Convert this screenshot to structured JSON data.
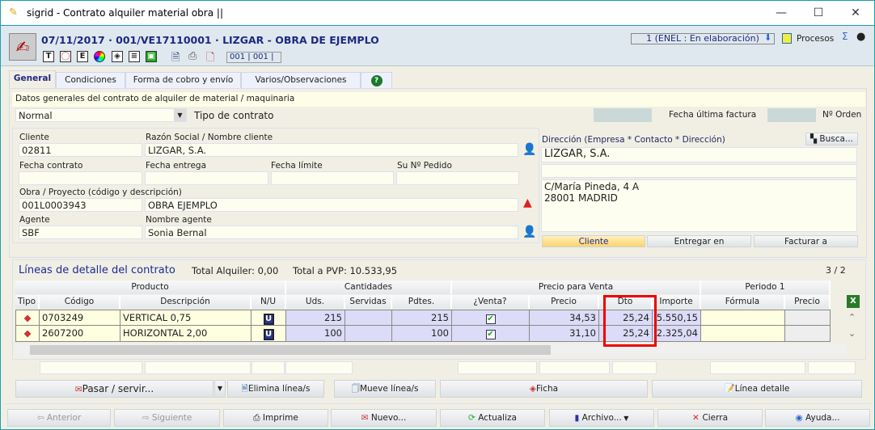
{
  "window": {
    "title": "sigrid - Contrato alquiler material obra ||",
    "controls": [
      "—",
      "☐",
      "✕"
    ]
  },
  "header": {
    "doc_title": "07/11/2017 · 001/VE17110001 · LIZGAR - OBRA DE EJEMPLO",
    "counter": "001 | 001 |",
    "status": "1 (ENEL : En elaboración)",
    "procesos": "Procesos",
    "sigma": "Σ",
    "toolbar_icons": [
      "T",
      "",
      "E",
      "",
      "",
      "",
      "",
      "",
      "",
      ""
    ]
  },
  "tabs": [
    {
      "label": "General"
    },
    {
      "label": "Condiciones"
    },
    {
      "label": "Forma de cobro y envío"
    },
    {
      "label": "Varios/Observaciones"
    },
    {
      "label": "?"
    }
  ],
  "general": {
    "section_title": "Datos generales del contrato de alquiler de material / maquinaria",
    "tipo_value": "Normal",
    "tipo_label": "Tipo de contrato",
    "fecha_ultima_factura_label": "Fecha última factura",
    "n_orden_label": "Nº Orden",
    "cliente_label": "Cliente",
    "cliente": "02811",
    "razon_label": "Razón Social / Nombre cliente",
    "razon": "LIZGAR, S.A.",
    "fecha_contrato_label": "Fecha contrato",
    "fecha_entrega_label": "Fecha entrega",
    "fecha_limite_label": "Fecha límite",
    "pedido_label": "Su Nº Pedido",
    "obra_label": "Obra / Proyecto (código y descripción)",
    "obra_codigo": "001L0003943",
    "obra_desc": "OBRA EJEMPLO",
    "agente_label": "Agente",
    "agente": "SBF",
    "nombre_agente_label": "Nombre agente",
    "nombre_agente": "Sonia Bernal"
  },
  "direccion": {
    "label": "Dirección (Empresa * Contacto * Dirección)",
    "busca": "Busca...",
    "empresa": "LIZGAR, S.A.",
    "contacto": "",
    "linea1": "C/María Pineda, 4 A",
    "linea2": "28001 MADRID",
    "tabs": [
      "Cliente",
      "Entregar en",
      "Facturar a"
    ]
  },
  "lines": {
    "title": "Líneas de detalle del contrato",
    "total_alquiler": "Total Alquiler: 0,00",
    "total_pvp": "Total a PVP: 10.533,95",
    "page": "3 / 2",
    "groups": [
      "Producto",
      "Cantidades",
      "Precio para Venta",
      "Periodo 1"
    ],
    "columns": [
      "Tipo",
      "Código",
      "Descripción",
      "N/U",
      "Uds.",
      "Servidas",
      "Pdtes.",
      "¿Venta?",
      "Precio",
      "Dto",
      "Importe",
      "Fórmula",
      "Precio"
    ],
    "rows": [
      {
        "codigo": "0703249",
        "descripcion": "VERTICAL 0,75",
        "nu": "U",
        "uds": "215",
        "servidas": "",
        "pdtes": "215",
        "venta": true,
        "precio": "34,53",
        "dto": "25,24",
        "importe": "5.550,15",
        "formula": "",
        "precio2": ""
      },
      {
        "codigo": "2607200",
        "descripcion": "HORIZONTAL 2,00",
        "nu": "U",
        "uds": "100",
        "servidas": "",
        "pdtes": "100",
        "venta": true,
        "precio": "31,10",
        "dto": "25,24",
        "importe": "2.325,04",
        "formula": "",
        "precio2": ""
      }
    ],
    "highlight_color": "#ee0000"
  },
  "actions": {
    "pasar": "Pasar / servir...",
    "elimina": "Elimina línea/s",
    "mueve": "Mueve línea/s",
    "ficha": "Ficha",
    "linea": "Línea detalle"
  },
  "bottom": {
    "anterior": "Anterior",
    "siguiente": "Siguiente",
    "imprime": "Imprime",
    "nuevo": "Nuevo...",
    "actualiza": "Actualiza",
    "archivo": "Archivo...",
    "cierra": "Cierra",
    "ayuda": "Ayuda..."
  }
}
